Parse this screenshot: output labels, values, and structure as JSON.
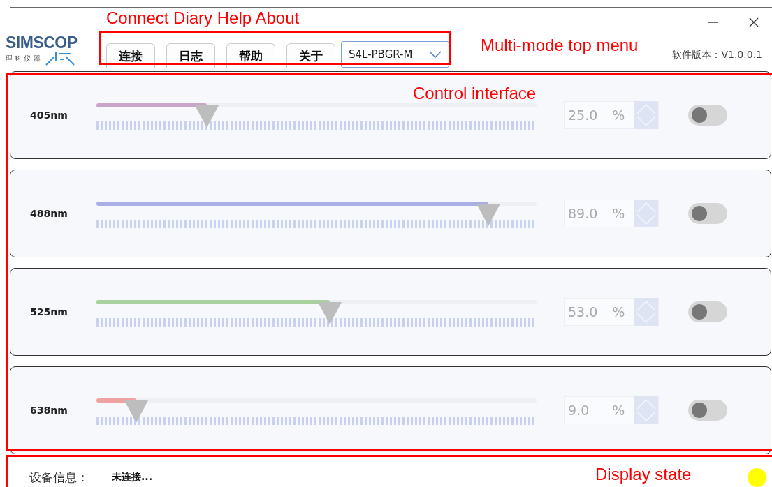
{
  "window": {
    "brand": "SIMSCOP",
    "brand_sub": "理 科 仪 器",
    "version": "软件版本：V1.0.0.1"
  },
  "menu": [
    {
      "label": "连接"
    },
    {
      "label": "日志"
    },
    {
      "label": "帮助"
    },
    {
      "label": "关于"
    }
  ],
  "model_select": {
    "value": "S4L-PBGR-M"
  },
  "channels": [
    {
      "name": "405nm",
      "level": 0.25,
      "value": "25.0",
      "unit": "%",
      "on": false,
      "color": "#c9a6c9"
    },
    {
      "name": "488nm",
      "level": 0.89,
      "value": "89.0",
      "unit": "%",
      "on": false,
      "color": "#a9aee6"
    },
    {
      "name": "525nm",
      "level": 0.53,
      "value": "53.0",
      "unit": "%",
      "on": false,
      "color": "#a9d1a0"
    },
    {
      "name": "638nm",
      "level": 0.09,
      "value": "9.0",
      "unit": "%",
      "on": false,
      "color": "#f0a2a2"
    }
  ],
  "status_bar": {
    "label": "设备信息：",
    "value": "未连接...",
    "color": "#ffff00"
  },
  "annotations": [
    {
      "kind": "menu",
      "label": "Connect Diary Help About"
    },
    {
      "kind": "menu-title",
      "label": "Multi-mode top menu"
    },
    {
      "kind": "control",
      "label": "Control interface"
    },
    {
      "kind": "status",
      "label": "Display state"
    }
  ]
}
